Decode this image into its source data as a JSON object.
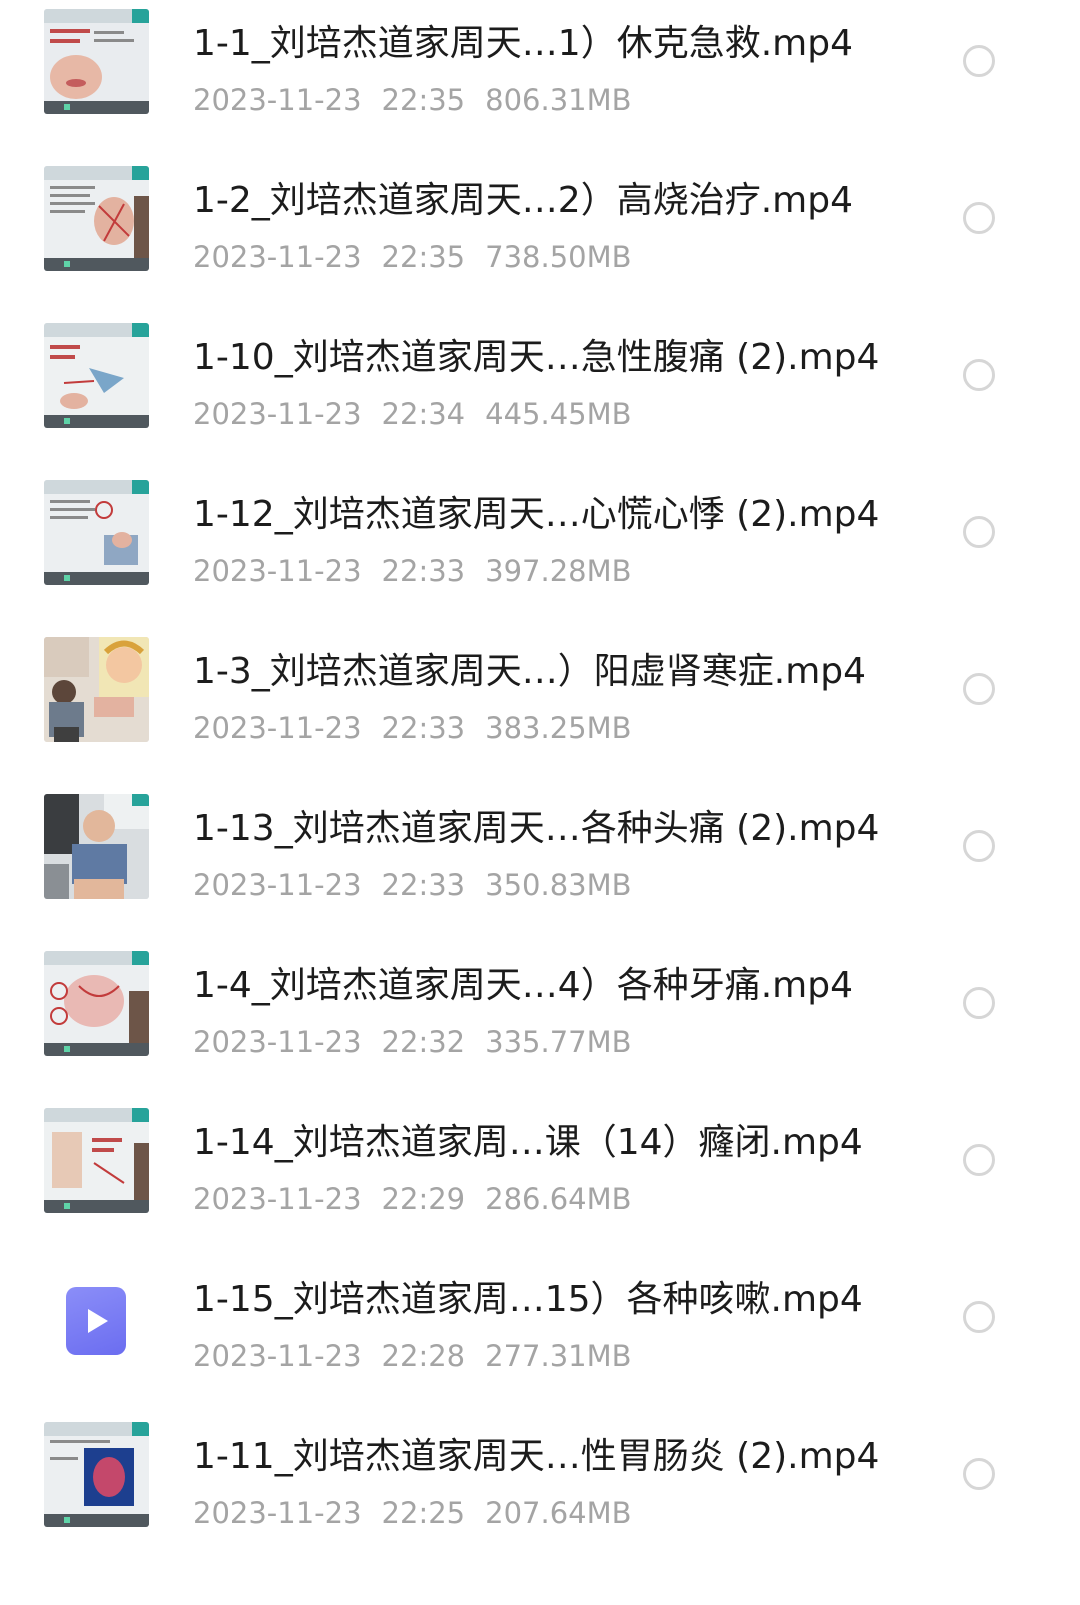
{
  "files": [
    {
      "name": "1-1_刘培杰道家周天…1）休克急救.mp4",
      "date": "2023-11-23",
      "time": "22:35",
      "size": "806.31MB",
      "thumb": "lecture-face-thumbnail"
    },
    {
      "name": "1-2_刘培杰道家周天…2）高烧治疗.mp4",
      "date": "2023-11-23",
      "time": "22:35",
      "size": "738.50MB",
      "thumb": "lecture-whiteboard-thumbnail"
    },
    {
      "name": "1-10_刘培杰道家周天…急性腹痛 (2).mp4",
      "date": "2023-11-23",
      "time": "22:34",
      "size": "445.45MB",
      "thumb": "lecture-whiteboard-thumbnail"
    },
    {
      "name": "1-12_刘培杰道家周天…心慌心悸 (2).mp4",
      "date": "2023-11-23",
      "time": "22:33",
      "size": "397.28MB",
      "thumb": "lecture-whiteboard-thumbnail"
    },
    {
      "name": "1-3_刘培杰道家周天…）阳虚肾寒症.mp4",
      "date": "2023-11-23",
      "time": "22:33",
      "size": "383.25MB",
      "thumb": "lecture-people-thumbnail"
    },
    {
      "name": "1-13_刘培杰道家周天…各种头痛 (2).mp4",
      "date": "2023-11-23",
      "time": "22:33",
      "size": "350.83MB",
      "thumb": "lecture-people-thumbnail"
    },
    {
      "name": "1-4_刘培杰道家周天…4）各种牙痛.mp4",
      "date": "2023-11-23",
      "time": "22:32",
      "size": "335.77MB",
      "thumb": "lecture-whiteboard-thumbnail"
    },
    {
      "name": "1-14_刘培杰道家周…课（14）癃闭.mp4",
      "date": "2023-11-23",
      "time": "22:29",
      "size": "286.64MB",
      "thumb": "lecture-whiteboard-thumbnail"
    },
    {
      "name": "1-15_刘培杰道家周…15）各种咳嗽.mp4",
      "date": "2023-11-23",
      "time": "22:28",
      "size": "277.31MB",
      "thumb": "video-file-icon"
    },
    {
      "name": "1-11_刘培杰道家周天…性胃肠炎 (2).mp4",
      "date": "2023-11-23",
      "time": "22:25",
      "size": "207.64MB",
      "thumb": "lecture-blue-slide-thumbnail"
    }
  ],
  "colors": {
    "name_text": "#1c1c1c",
    "meta_text": "#a4a4a4",
    "checkbox_border": "#d6d6d6",
    "video_icon": "#7b7df4"
  }
}
